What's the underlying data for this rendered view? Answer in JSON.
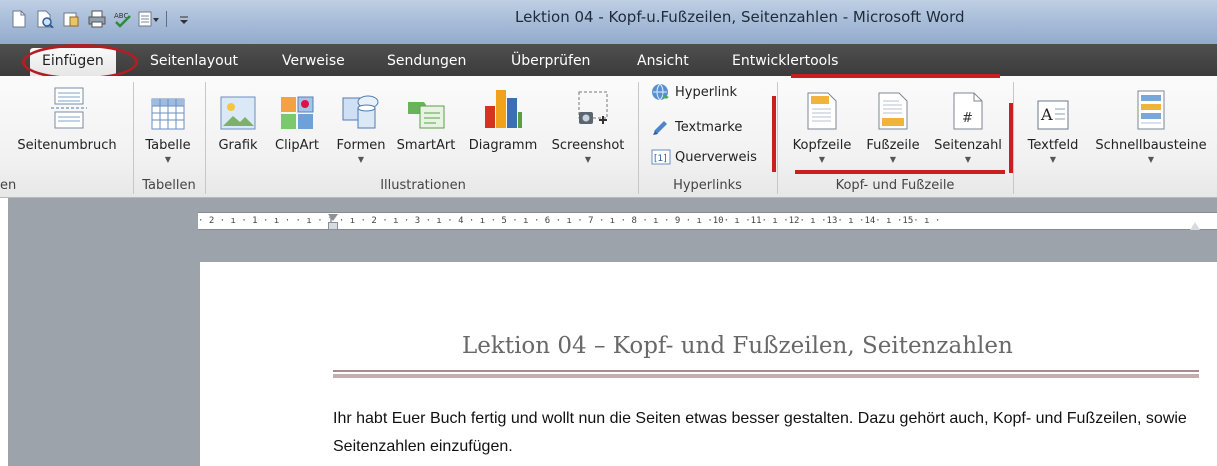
{
  "window": {
    "title": "Lektion 04 - Kopf-u.Fußzeilen, Seitenzahlen  -  Microsoft Word"
  },
  "quick_access": [
    "new-document-icon",
    "print-preview-icon",
    "open-icon",
    "print-icon",
    "spelling-icon",
    "dropdown-icon",
    "customize-icon"
  ],
  "tabs": {
    "einfuegen": "Einfügen",
    "seitenlayout": "Seitenlayout",
    "verweise": "Verweise",
    "sendungen": "Sendungen",
    "ueberpruefen": "Überprüfen",
    "ansicht": "Ansicht",
    "entwicklertools": "Entwicklertools"
  },
  "ribbon": {
    "seitenumbruch": "Seitenumbruch",
    "group_seiten_partial": "en",
    "tabelle": "Tabelle",
    "group_tabellen": "Tabellen",
    "grafik": "Grafik",
    "clipart": "ClipArt",
    "formen": "Formen",
    "smartart": "SmartArt",
    "diagramm": "Diagramm",
    "screenshot": "Screenshot",
    "group_illustrationen": "Illustrationen",
    "hyperlink": "Hyperlink",
    "textmarke": "Textmarke",
    "querverweis": "Querverweis",
    "group_hyperlinks": "Hyperlinks",
    "kopfzeile": "Kopfzeile",
    "fusszeile": "Fußzeile",
    "seitenzahl": "Seitenzahl",
    "group_kopf_fuss": "Kopf- und Fußzeile",
    "textfeld": "Textfeld",
    "schnellbausteine": "Schnellbausteine"
  },
  "ruler": {
    "ticks": "· 2 · ı · 1 · ı ·    · ı · 1 · ı · 2 · ı · 3 · ı · 4 · ı · 5 · ı · 6 · ı · 7 · ı · 8 · ı · 9 · ı ·10· ı ·11· ı ·12· ı ·13· ı ·14· ı ·15· ı ·"
  },
  "document": {
    "title": "Lektion 04 – Kopf- und Fußzeilen, Seitenzahlen",
    "paragraph": "Ihr habt Euer Buch fertig und wollt nun die Seiten etwas besser gestalten. Dazu gehört auch, Kopf- und Fußzeilen, sowie Seitenzahlen einzufügen."
  },
  "colors": {
    "annotation_red": "#c9201f",
    "tab_bar": "#3b3b3b",
    "title_bar": "#a7bcd8"
  }
}
